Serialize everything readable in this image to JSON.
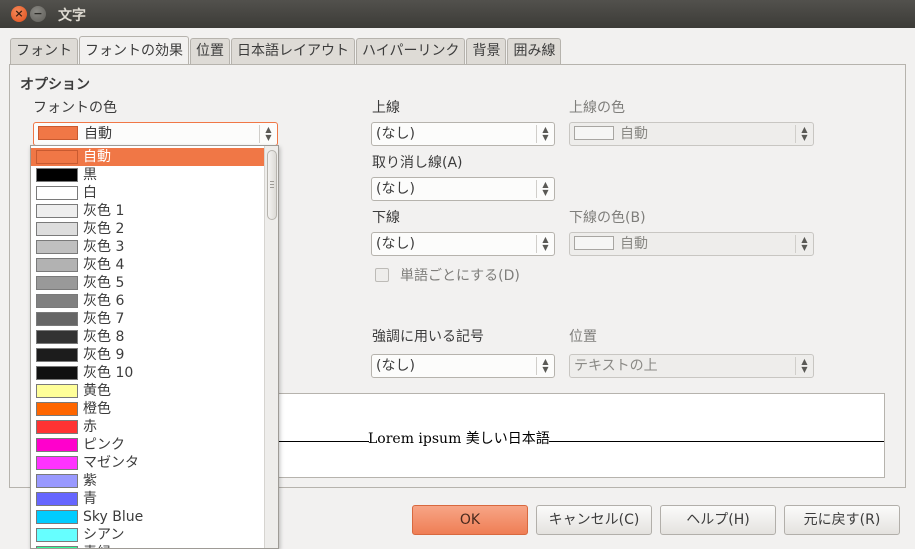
{
  "window": {
    "title": "文字",
    "close_glyph": "×",
    "min_glyph": "−"
  },
  "tabs": [
    {
      "label": "フォント",
      "active": false
    },
    {
      "label": "フォントの効果",
      "active": true
    },
    {
      "label": "位置",
      "active": false
    },
    {
      "label": "日本語レイアウト",
      "active": false
    },
    {
      "label": "ハイパーリンク",
      "active": false
    },
    {
      "label": "背景",
      "active": false
    },
    {
      "label": "囲み線",
      "active": false
    }
  ],
  "options": {
    "heading": "オプション",
    "font_color_label": "フォントの色",
    "font_color_value": "自動",
    "font_color_swatch": "#f07746",
    "overline_label": "上線",
    "overline_value": "(なし)",
    "overline_color_label": "上線の色",
    "overline_color_value": "自動",
    "strikeout_label": "取り消し線(A)",
    "strikeout_value": "(なし)",
    "underline_label": "下線",
    "underline_value": "(なし)",
    "underline_color_label": "下線の色(B)",
    "underline_color_value": "自動",
    "word_by_word_label": "単語ごとにする(D)",
    "emphasis_label": "強調に用いる記号",
    "emphasis_value": "(なし)",
    "position_label": "位置",
    "position_value": "テキストの上"
  },
  "preview": {
    "text": "Lorem ipsum   美しい日本語"
  },
  "buttons": {
    "ok": "OK",
    "cancel": "キャンセル(C)",
    "help": "ヘルプ(H)",
    "reset": "元に戻す(R)"
  },
  "color_list": [
    {
      "name": "自動",
      "color": "#f07746",
      "selected": true
    },
    {
      "name": "黒",
      "color": "#000000"
    },
    {
      "name": "白",
      "color": "#ffffff"
    },
    {
      "name": "灰色 1",
      "color": "#eeeeee"
    },
    {
      "name": "灰色 2",
      "color": "#dddddd"
    },
    {
      "name": "灰色 3",
      "color": "#c0c0c0"
    },
    {
      "name": "灰色 4",
      "color": "#b2b2b2"
    },
    {
      "name": "灰色 5",
      "color": "#999999"
    },
    {
      "name": "灰色 6",
      "color": "#808080"
    },
    {
      "name": "灰色 7",
      "color": "#666666"
    },
    {
      "name": "灰色 8",
      "color": "#333333"
    },
    {
      "name": "灰色 9",
      "color": "#1c1c1c"
    },
    {
      "name": "灰色 10",
      "color": "#111111"
    },
    {
      "name": "黄色",
      "color": "#ffff99"
    },
    {
      "name": "橙色",
      "color": "#ff6600"
    },
    {
      "name": "赤",
      "color": "#ff3333"
    },
    {
      "name": "ピンク",
      "color": "#ff00cc"
    },
    {
      "name": "マゼンタ",
      "color": "#ff33ff"
    },
    {
      "name": "紫",
      "color": "#9999ff"
    },
    {
      "name": "青",
      "color": "#6666ff"
    },
    {
      "name": "Sky Blue",
      "color": "#00ccff"
    },
    {
      "name": "シアン",
      "color": "#66ffff"
    },
    {
      "name": "青緑",
      "color": "#33ff99"
    }
  ]
}
